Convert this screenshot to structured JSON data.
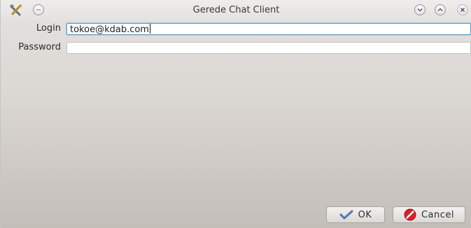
{
  "window": {
    "title": "Gerede Chat Client",
    "app_icon": "app-tools-icon",
    "titlebar_buttons": [
      "menu-circle-icon",
      "minimize-icon",
      "maximize-icon",
      "close-icon"
    ]
  },
  "form": {
    "login_label": "Login",
    "login_value": "tokoe@kdab.com",
    "password_label": "Password",
    "password_value": ""
  },
  "buttons": {
    "ok_label": "OK",
    "ok_icon": "checkmark-icon",
    "cancel_label": "Cancel",
    "cancel_icon": "cancel-icon"
  },
  "colors": {
    "focus_border": "#5f97c9",
    "cancel_red": "#d8202a",
    "ok_check": "#4a6fa3"
  }
}
